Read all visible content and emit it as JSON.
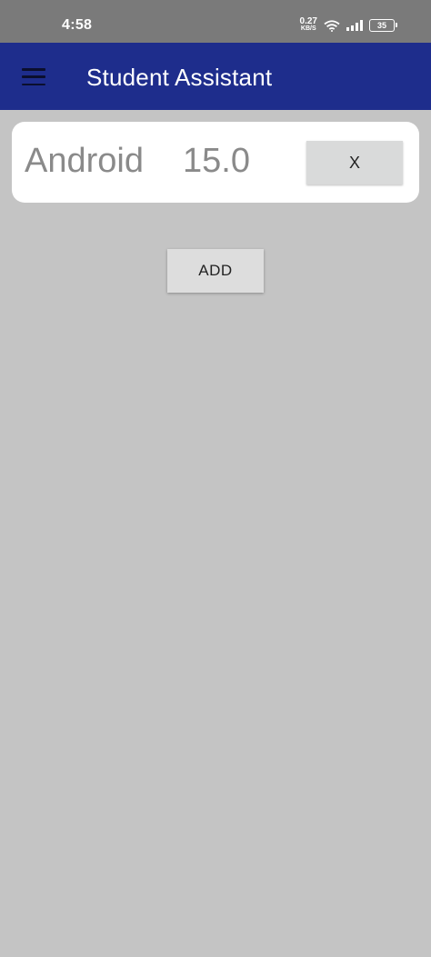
{
  "status_bar": {
    "time": "4:58",
    "net_speed_value": "0.27",
    "net_speed_unit": "KB/S",
    "battery": "35",
    "icons": [
      "wifi-icon",
      "signal-icon",
      "battery-icon"
    ]
  },
  "app_bar": {
    "title": "Student Assistant",
    "menu_icon": "hamburger-menu-icon",
    "color": "#1e2d8c"
  },
  "items": [
    {
      "name": "Android",
      "version": "15.0",
      "remove_label": "X"
    }
  ],
  "add_button": {
    "label": "ADD"
  },
  "colors": {
    "background": "#c4c4c4",
    "card": "#ffffff",
    "button": "#d9dada"
  }
}
